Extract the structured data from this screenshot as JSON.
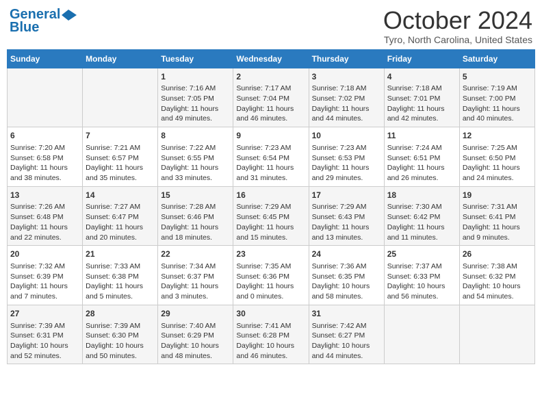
{
  "header": {
    "logo_line1": "General",
    "logo_line2": "Blue",
    "month": "October 2024",
    "location": "Tyro, North Carolina, United States"
  },
  "days_of_week": [
    "Sunday",
    "Monday",
    "Tuesday",
    "Wednesday",
    "Thursday",
    "Friday",
    "Saturday"
  ],
  "weeks": [
    [
      {
        "day": "",
        "info": ""
      },
      {
        "day": "",
        "info": ""
      },
      {
        "day": "1",
        "info": "Sunrise: 7:16 AM\nSunset: 7:05 PM\nDaylight: 11 hours and 49 minutes."
      },
      {
        "day": "2",
        "info": "Sunrise: 7:17 AM\nSunset: 7:04 PM\nDaylight: 11 hours and 46 minutes."
      },
      {
        "day": "3",
        "info": "Sunrise: 7:18 AM\nSunset: 7:02 PM\nDaylight: 11 hours and 44 minutes."
      },
      {
        "day": "4",
        "info": "Sunrise: 7:18 AM\nSunset: 7:01 PM\nDaylight: 11 hours and 42 minutes."
      },
      {
        "day": "5",
        "info": "Sunrise: 7:19 AM\nSunset: 7:00 PM\nDaylight: 11 hours and 40 minutes."
      }
    ],
    [
      {
        "day": "6",
        "info": "Sunrise: 7:20 AM\nSunset: 6:58 PM\nDaylight: 11 hours and 38 minutes."
      },
      {
        "day": "7",
        "info": "Sunrise: 7:21 AM\nSunset: 6:57 PM\nDaylight: 11 hours and 35 minutes."
      },
      {
        "day": "8",
        "info": "Sunrise: 7:22 AM\nSunset: 6:55 PM\nDaylight: 11 hours and 33 minutes."
      },
      {
        "day": "9",
        "info": "Sunrise: 7:23 AM\nSunset: 6:54 PM\nDaylight: 11 hours and 31 minutes."
      },
      {
        "day": "10",
        "info": "Sunrise: 7:23 AM\nSunset: 6:53 PM\nDaylight: 11 hours and 29 minutes."
      },
      {
        "day": "11",
        "info": "Sunrise: 7:24 AM\nSunset: 6:51 PM\nDaylight: 11 hours and 26 minutes."
      },
      {
        "day": "12",
        "info": "Sunrise: 7:25 AM\nSunset: 6:50 PM\nDaylight: 11 hours and 24 minutes."
      }
    ],
    [
      {
        "day": "13",
        "info": "Sunrise: 7:26 AM\nSunset: 6:48 PM\nDaylight: 11 hours and 22 minutes."
      },
      {
        "day": "14",
        "info": "Sunrise: 7:27 AM\nSunset: 6:47 PM\nDaylight: 11 hours and 20 minutes."
      },
      {
        "day": "15",
        "info": "Sunrise: 7:28 AM\nSunset: 6:46 PM\nDaylight: 11 hours and 18 minutes."
      },
      {
        "day": "16",
        "info": "Sunrise: 7:29 AM\nSunset: 6:45 PM\nDaylight: 11 hours and 15 minutes."
      },
      {
        "day": "17",
        "info": "Sunrise: 7:29 AM\nSunset: 6:43 PM\nDaylight: 11 hours and 13 minutes."
      },
      {
        "day": "18",
        "info": "Sunrise: 7:30 AM\nSunset: 6:42 PM\nDaylight: 11 hours and 11 minutes."
      },
      {
        "day": "19",
        "info": "Sunrise: 7:31 AM\nSunset: 6:41 PM\nDaylight: 11 hours and 9 minutes."
      }
    ],
    [
      {
        "day": "20",
        "info": "Sunrise: 7:32 AM\nSunset: 6:39 PM\nDaylight: 11 hours and 7 minutes."
      },
      {
        "day": "21",
        "info": "Sunrise: 7:33 AM\nSunset: 6:38 PM\nDaylight: 11 hours and 5 minutes."
      },
      {
        "day": "22",
        "info": "Sunrise: 7:34 AM\nSunset: 6:37 PM\nDaylight: 11 hours and 3 minutes."
      },
      {
        "day": "23",
        "info": "Sunrise: 7:35 AM\nSunset: 6:36 PM\nDaylight: 11 hours and 0 minutes."
      },
      {
        "day": "24",
        "info": "Sunrise: 7:36 AM\nSunset: 6:35 PM\nDaylight: 10 hours and 58 minutes."
      },
      {
        "day": "25",
        "info": "Sunrise: 7:37 AM\nSunset: 6:33 PM\nDaylight: 10 hours and 56 minutes."
      },
      {
        "day": "26",
        "info": "Sunrise: 7:38 AM\nSunset: 6:32 PM\nDaylight: 10 hours and 54 minutes."
      }
    ],
    [
      {
        "day": "27",
        "info": "Sunrise: 7:39 AM\nSunset: 6:31 PM\nDaylight: 10 hours and 52 minutes."
      },
      {
        "day": "28",
        "info": "Sunrise: 7:39 AM\nSunset: 6:30 PM\nDaylight: 10 hours and 50 minutes."
      },
      {
        "day": "29",
        "info": "Sunrise: 7:40 AM\nSunset: 6:29 PM\nDaylight: 10 hours and 48 minutes."
      },
      {
        "day": "30",
        "info": "Sunrise: 7:41 AM\nSunset: 6:28 PM\nDaylight: 10 hours and 46 minutes."
      },
      {
        "day": "31",
        "info": "Sunrise: 7:42 AM\nSunset: 6:27 PM\nDaylight: 10 hours and 44 minutes."
      },
      {
        "day": "",
        "info": ""
      },
      {
        "day": "",
        "info": ""
      }
    ]
  ]
}
